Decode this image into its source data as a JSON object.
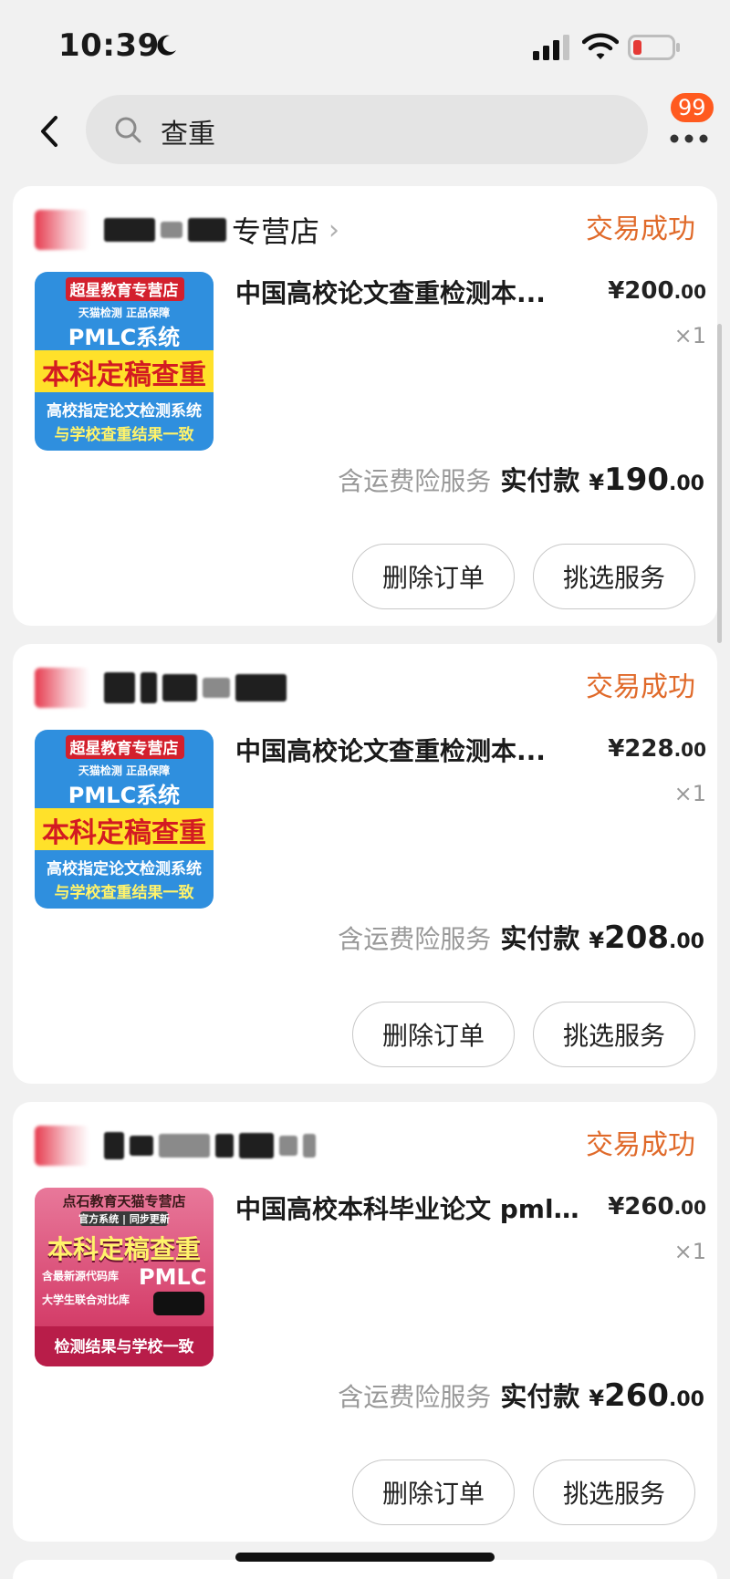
{
  "status_bar": {
    "time": "10:39"
  },
  "search": {
    "query": "查重",
    "badge_count": "99"
  },
  "orders": [
    {
      "shop_name_tail": "专营店",
      "status": "交易成功",
      "thumb": {
        "style": "blue",
        "lines": [
          "超星教育专营店",
          "天猫检测  正品保障",
          "PMLC系统",
          "本科定稿查重",
          "高校指定论文检测系统",
          "与学校查重结果一致"
        ]
      },
      "title": "中国高校论文查重检测本...",
      "price_int": "¥200",
      "price_dec": ".00",
      "qty": "×1",
      "pay_note": "含运费险服务",
      "pay_label": "实付款",
      "pay_currency": "¥",
      "pay_int": "190",
      "pay_dec": ".00",
      "btn_delete": "删除订单",
      "btn_service": "挑选服务"
    },
    {
      "shop_name_tail": "",
      "status": "交易成功",
      "thumb": {
        "style": "blue",
        "lines": [
          "超星教育专营店",
          "天猫检测  正品保障",
          "PMLC系统",
          "本科定稿查重",
          "高校指定论文检测系统",
          "与学校查重结果一致"
        ]
      },
      "title": "中国高校论文查重检测本...",
      "price_int": "¥228",
      "price_dec": ".00",
      "qty": "×1",
      "pay_note": "含运费险服务",
      "pay_label": "实付款",
      "pay_currency": "¥",
      "pay_int": "208",
      "pay_dec": ".00",
      "btn_delete": "删除订单",
      "btn_service": "挑选服务"
    },
    {
      "shop_name_tail": "",
      "status": "交易成功",
      "thumb": {
        "style": "pink",
        "lines": [
          "点石教育天猫专营店",
          "官方系统 | 同步更新",
          "本科定稿查重",
          "含最新源代码库",
          "PMLC",
          "大学生联合对比库",
          "检测结果与学校一致"
        ]
      },
      "title": "中国高校本科毕业论文 pml...",
      "price_int": "¥260",
      "price_dec": ".00",
      "qty": "×1",
      "pay_note": "含运费险服务",
      "pay_label": "实付款",
      "pay_currency": "¥",
      "pay_int": "260",
      "pay_dec": ".00",
      "btn_delete": "删除订单",
      "btn_service": "挑选服务"
    }
  ]
}
